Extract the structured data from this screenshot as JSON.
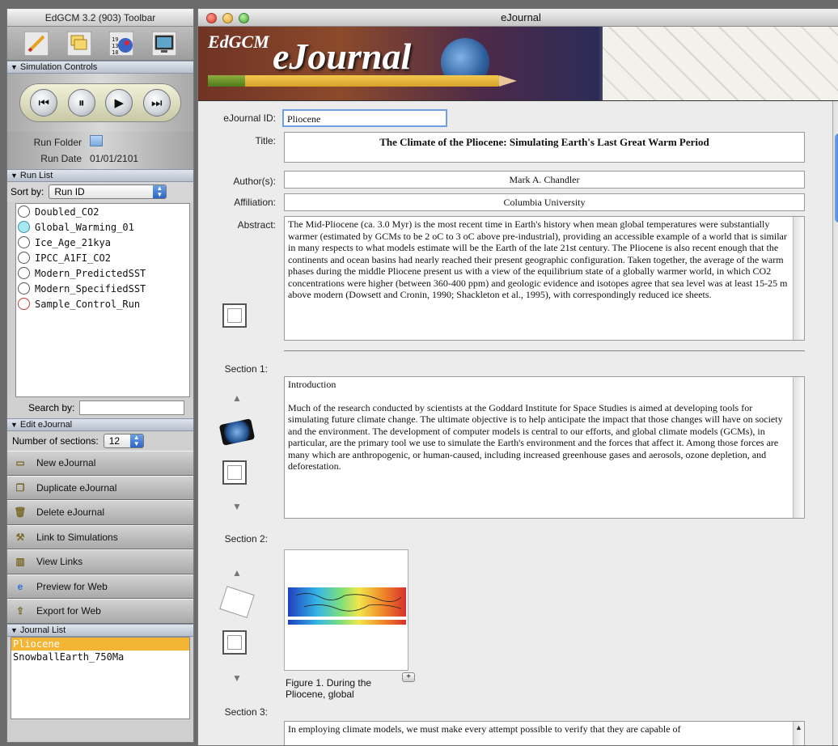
{
  "toolbar": {
    "title": "EdGCM 3.2 (903) Toolbar",
    "icons": [
      "pencil-icon",
      "stack-icon",
      "data-icon",
      "monitor-icon"
    ],
    "sim_controls_header": "Simulation Controls",
    "run_folder_label": "Run Folder",
    "run_date_label": "Run Date",
    "run_date_value": "01/01/2101",
    "run_list_header": "Run List",
    "sort_by_label": "Sort by:",
    "sort_by_value": "Run ID",
    "runs": [
      {
        "name": "Doubled_CO2",
        "color": "#ffffff",
        "border": "#555555"
      },
      {
        "name": "Global_Warming_01",
        "color": "#a7e8f2",
        "border": "#3f8fa0"
      },
      {
        "name": "Ice_Age_21kya",
        "color": "#ffffff",
        "border": "#555555"
      },
      {
        "name": "IPCC_A1FI_CO2",
        "color": "#ffffff",
        "border": "#555555"
      },
      {
        "name": "Modern_PredictedSST",
        "color": "#ffffff",
        "border": "#555555"
      },
      {
        "name": "Modern_SpecifiedSST",
        "color": "#ffffff",
        "border": "#555555"
      },
      {
        "name": "Sample_Control_Run",
        "color": "#ffffff",
        "border": "#c63a3a"
      }
    ],
    "search_label": "Search by:",
    "edit_header": "Edit eJournal",
    "num_sections_label": "Number of sections:",
    "num_sections_value": "12",
    "actions": [
      {
        "label": "New eJournal",
        "icon": "new-journal-icon"
      },
      {
        "label": "Duplicate eJournal",
        "icon": "duplicate-icon"
      },
      {
        "label": "Delete eJournal",
        "icon": "trash-icon"
      },
      {
        "label": "Link to Simulations",
        "icon": "link-tools-icon"
      },
      {
        "label": "View Links",
        "icon": "view-links-icon"
      },
      {
        "label": "Preview for Web",
        "icon": "browser-icon"
      },
      {
        "label": "Export for Web",
        "icon": "export-icon"
      }
    ],
    "journal_list_header": "Journal List",
    "journals": [
      "Pliocene",
      "SnowballEarth_750Ma"
    ]
  },
  "ejournal": {
    "window_title": "eJournal",
    "banner_small": "EdGCM",
    "banner_big": "eJournal",
    "id_label": "eJournal ID:",
    "id_value": "Pliocene",
    "title_label": "Title:",
    "title_value": "The Climate of the Pliocene: Simulating Earth's Last Great Warm Period",
    "authors_label": "Author(s):",
    "authors_value": "Mark A. Chandler",
    "affiliation_label": "Affiliation:",
    "affiliation_value": "Columbia University",
    "abstract_label": "Abstract:",
    "abstract_value": "The Mid-Pliocene (ca. 3.0 Myr) is the most recent time in Earth's history when mean global temperatures were substantially warmer (estimated by GCMs to be 2 oC to 3 oC above pre-industrial), providing an accessible example of a world that is similar in many respects to what models estimate will be the Earth of the late 21st century. The Pliocene is also recent enough that the continents and ocean basins had nearly reached their present geographic configuration. Taken together, the average of the warm phases during the middle Pliocene present us with a view of the equilibrium state of a globally warmer world, in which CO2 concentrations were higher (between 360-400 ppm) and geologic evidence and isotopes agree that sea level was at least 15-25 m above modern (Dowsett and Cronin, 1990; Shackleton et al., 1995), with correspondingly reduced ice sheets.",
    "section1_label": "Section 1:",
    "section1_heading": "Introduction",
    "section1_body": "Much of the research conducted by scientists at the Goddard Institute for Space Studies is aimed at developing tools for simulating future climate change. The ultimate objective is to help anticipate the impact that those changes will have on society and the environment. The development of computer models is central to our efforts, and global climate models (GCMs), in particular, are the primary tool we use to simulate the Earth's environment and the forces that affect it. Among those forces are many which are anthropogenic, or human-caused, including increased greenhouse gases and aerosols, ozone depletion, and deforestation.",
    "section2_label": "Section 2:",
    "figure_caption": "Figure 1. During the Pliocene, global",
    "section3_label": "Section 3:",
    "section3_body": "In employing climate models, we must make every attempt possible to verify that they are capable of"
  }
}
